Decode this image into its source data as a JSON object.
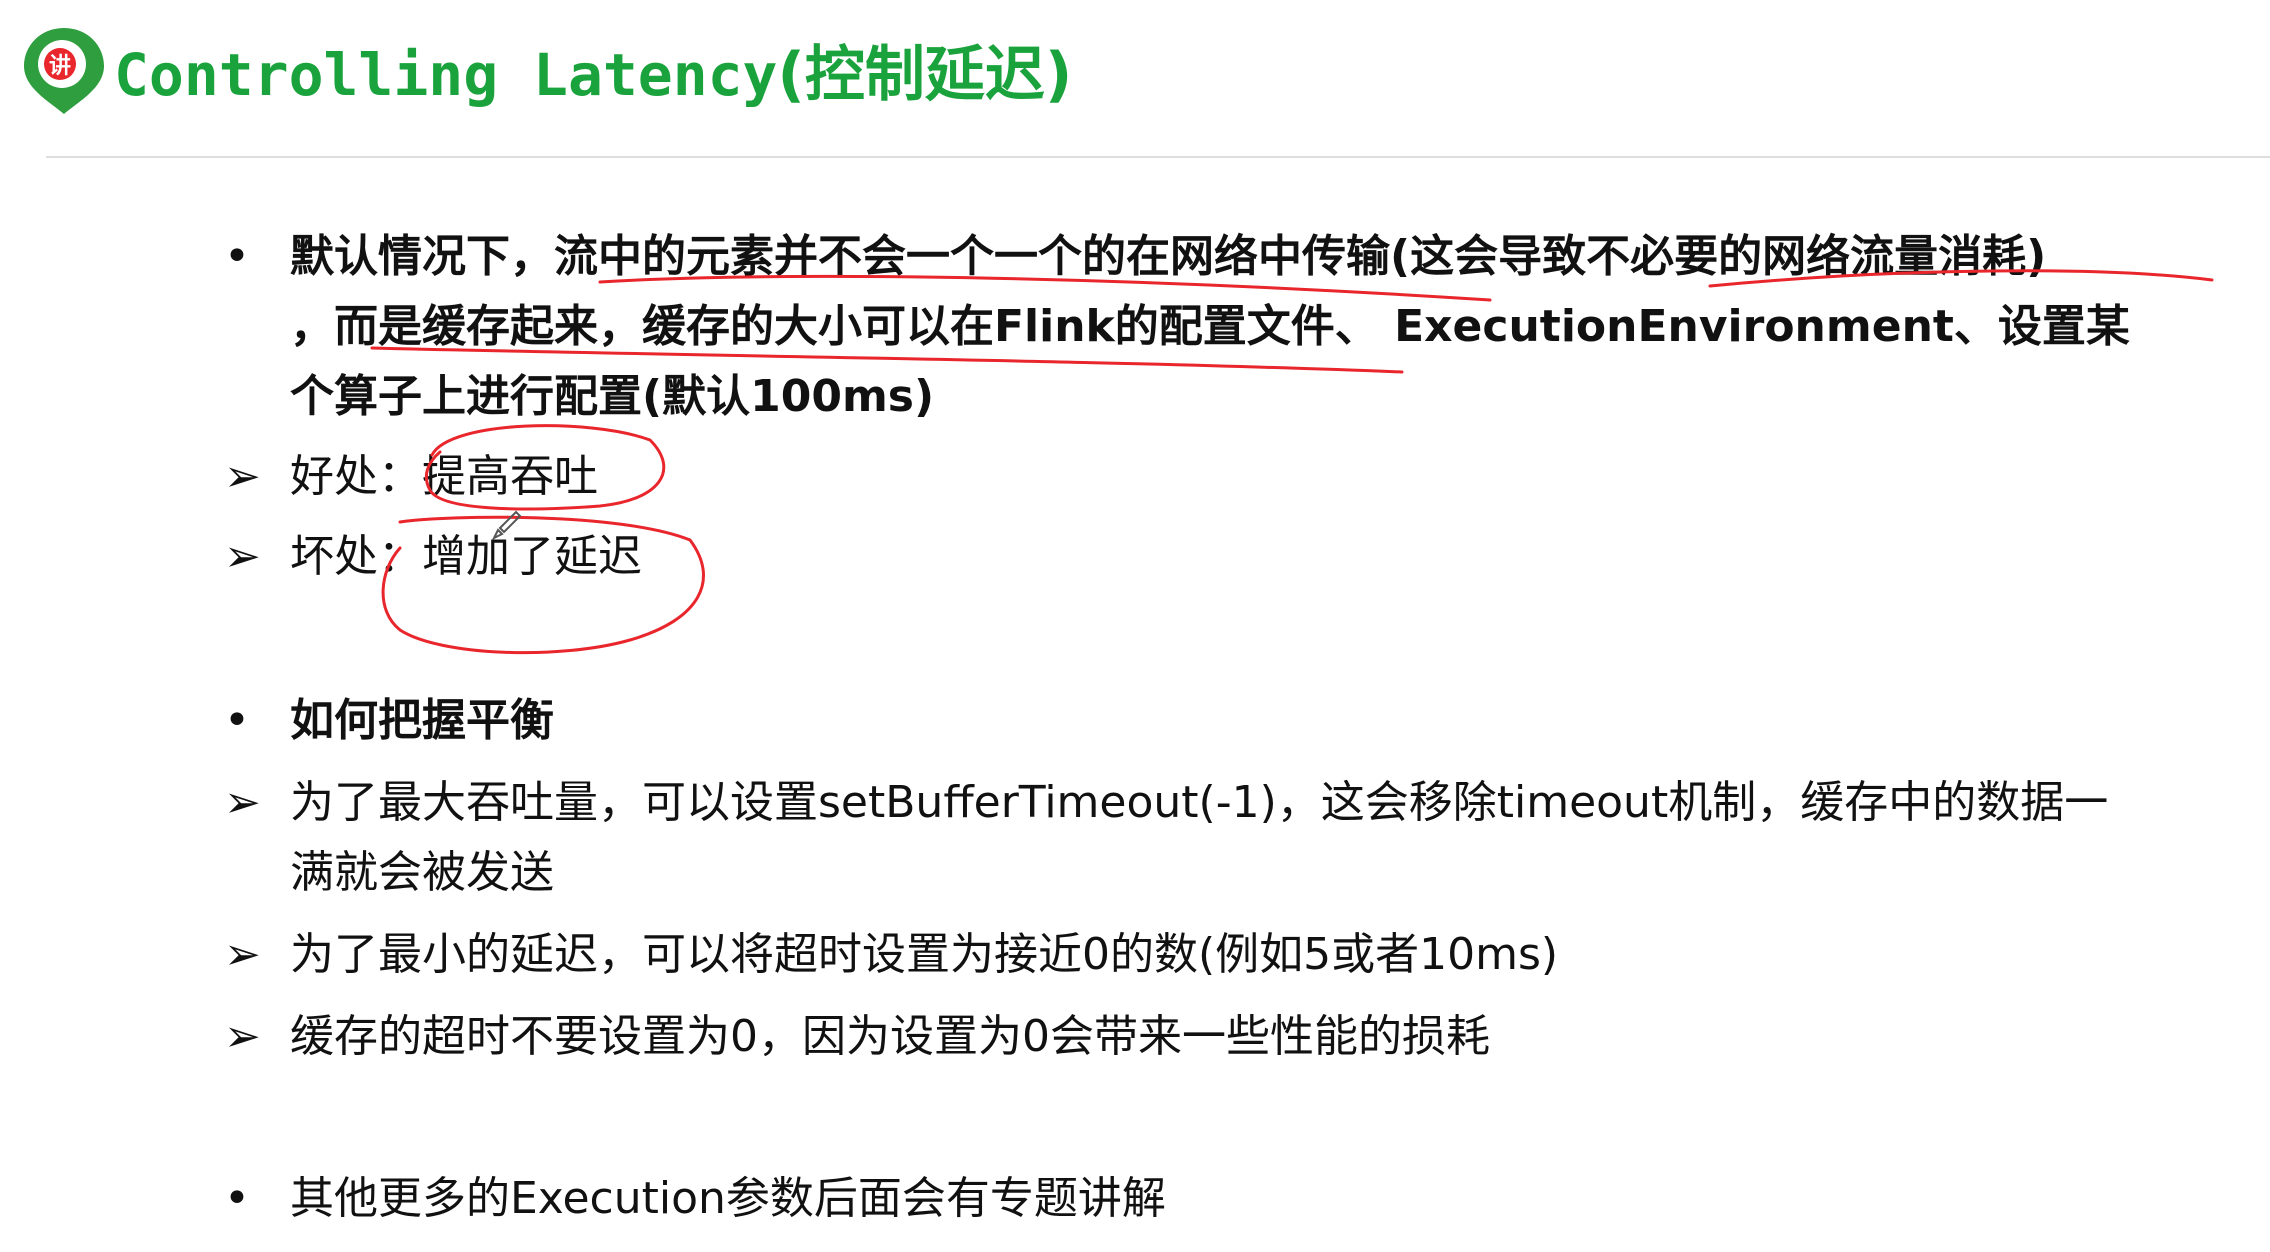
{
  "header": {
    "title_en": "Controlling Latency",
    "title_cn": "(控制延迟)",
    "logo_glyph": "讲"
  },
  "content": {
    "p1_line1": "默认情况下，流中的元素并不会一个一个的在网络中传输(这会导致不必要的网络流量消耗)",
    "p1_line2": "，而是缓存起来，缓存的大小可以在Flink的配置文件、 ExecutionEnvironment、设置某",
    "p1_line3": "个算子上进行配置(默认100ms)",
    "benefit": "好处：提高吞吐",
    "drawback": "坏处：增加了延迟",
    "balance_heading": "如何把握平衡",
    "tip1_line1": "为了最大吞吐量，可以设置setBufferTimeout(-1)，这会移除timeout机制，缓存中的数据一",
    "tip1_line2": "满就会被发送",
    "tip2": "为了最小的延迟，可以将超时设置为接近0的数(例如5或者10ms)",
    "tip3": "缓存的超时不要设置为0，因为设置为0会带来一些性能的损耗",
    "more": "其他更多的Execution参数后面会有专题讲解"
  },
  "markers": {
    "bullet": "•",
    "arrow": "➢"
  },
  "colors": {
    "title": "#1aa33d",
    "annotation": "#e8262c",
    "logo": "#2e9e3e",
    "logo_badge": "#e8262c"
  },
  "icons": {
    "logo": "location-pin-icon"
  }
}
